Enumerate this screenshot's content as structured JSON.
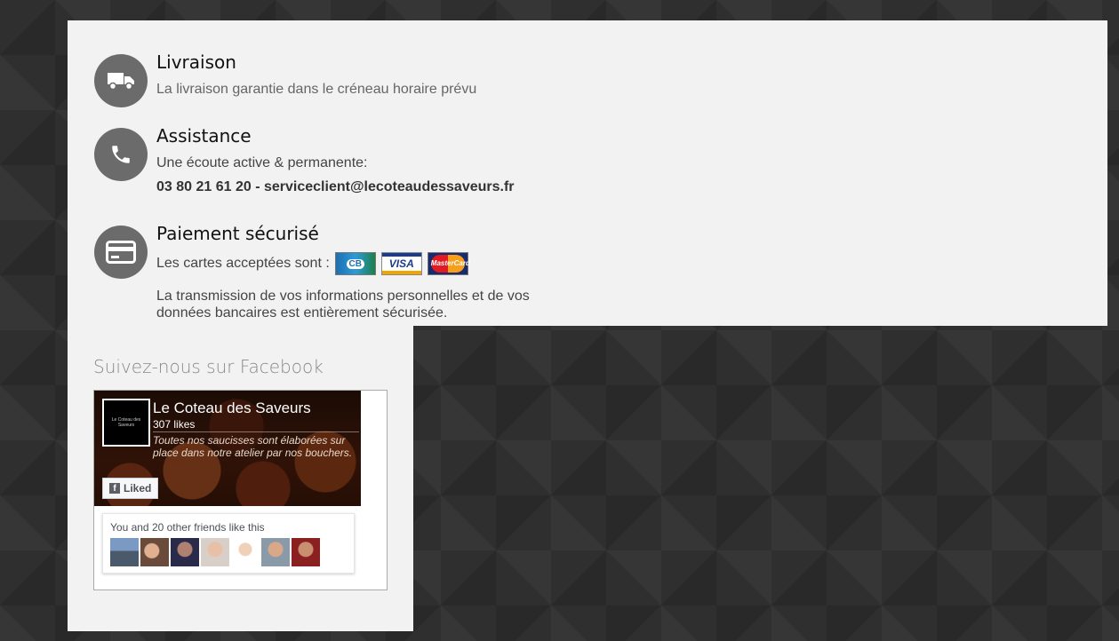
{
  "features": {
    "delivery": {
      "icon": "truck-icon",
      "title": "Livraison",
      "text": "La livraison garantie dans le créneau horaire prévu"
    },
    "assistance": {
      "icon": "phone-icon",
      "title": "Assistance",
      "text": "Une écoute active & permanente:",
      "contact": "03 80 21 61 20 - serviceclient@lecoteaudessaveurs.fr"
    },
    "payment": {
      "icon": "credit-card-icon",
      "title": "Paiement sécurisé",
      "cards_label": "Les cartes acceptées sont :",
      "cards": [
        "CB",
        "VISA",
        "MasterCard"
      ],
      "secure_text": "La transmission de vos informations personnelles et de vos données bancaires est entièrement sécurisée."
    }
  },
  "facebook": {
    "heading": "Suivez-nous sur Facebook",
    "page_name": "Le Coteau des Saveurs",
    "logo_text": "Le Coteau des Saveurs",
    "likes": "307 likes",
    "description": "Toutes nos saucisses sont élaborées sur place dans notre atelier par nos bouchers.",
    "liked_label": "Liked",
    "friends_text": "You and 20 other friends like this"
  },
  "colors": {
    "background": "#2f2f2f",
    "panel": "#f2f2f2",
    "icon_circle": "#6b6b6b"
  }
}
